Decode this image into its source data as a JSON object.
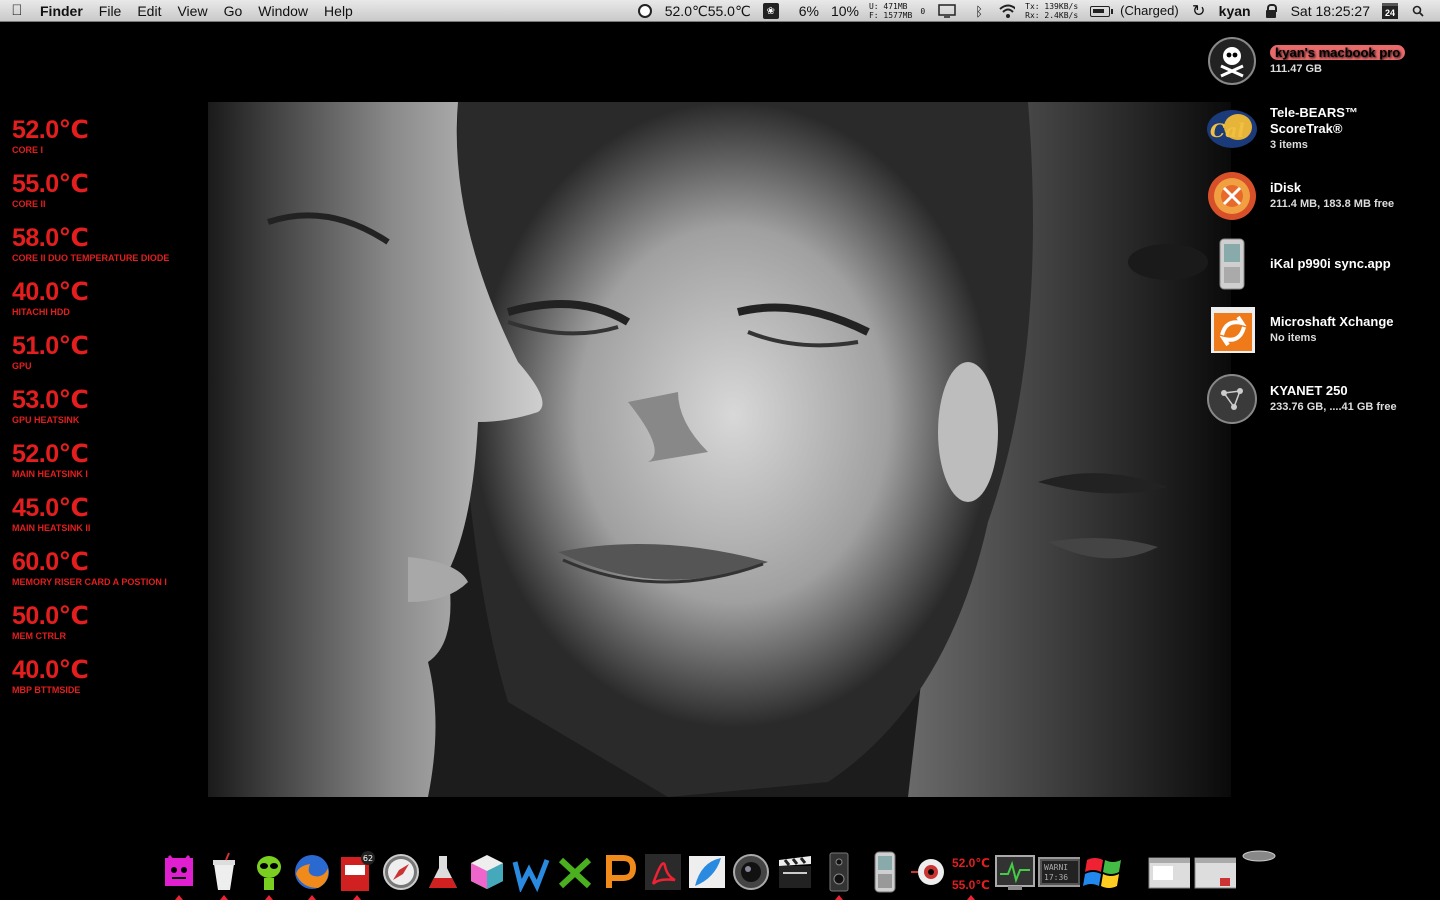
{
  "menubar": {
    "app_name": "Finder",
    "menus": [
      "File",
      "Edit",
      "View",
      "Go",
      "Window",
      "Help"
    ],
    "temp1": "52.0℃",
    "temp2": "55.0℃",
    "cpu1": "6%",
    "cpu2": "10%",
    "mem_u": "U:   471MB",
    "mem_f": "F: 1577MB",
    "disk_count": "0",
    "net_tx": "Tx:  139KB/s",
    "net_rx": "Rx:   2.4KB/s",
    "battery_status": "(Charged)",
    "user": "kyan",
    "clock": "Sat 18:25:27",
    "calendar_day": "24"
  },
  "temperature_sensors": [
    {
      "value": "52.0℃",
      "label": "CORE I"
    },
    {
      "value": "55.0℃",
      "label": "CORE II"
    },
    {
      "value": "58.0℃",
      "label": "CORE II DUO TEMPERATURE DIODE"
    },
    {
      "value": "40.0℃",
      "label": "HITACHI HDD"
    },
    {
      "value": "51.0℃",
      "label": "GPU"
    },
    {
      "value": "53.0℃",
      "label": "GPU HEATSINK"
    },
    {
      "value": "52.0℃",
      "label": "MAIN HEATSINK I"
    },
    {
      "value": "45.0℃",
      "label": "MAIN HEATSINK II"
    },
    {
      "value": "60.0℃",
      "label": "MEMORY RISER CARD A POSTION I"
    },
    {
      "value": "50.0℃",
      "label": "MEM CTRLR"
    },
    {
      "value": "40.0℃",
      "label": "MBP BTTMSIDE"
    }
  ],
  "desktop_icons": [
    {
      "name": "kyan's macbook pro",
      "sub": "111.47 GB",
      "icon": "skull-drive-icon"
    },
    {
      "name": "Tele-BEARS™",
      "name2": "ScoreTrak®",
      "sub": "3 items",
      "icon": "cal-bears-icon"
    },
    {
      "name": "iDisk",
      "sub": "211.4 MB, 183.8 MB free",
      "icon": "idisk-icon"
    },
    {
      "name": "iKal p990i sync.app",
      "sub": "",
      "icon": "phone-app-icon"
    },
    {
      "name": "Microshaft Xchange",
      "sub": "No items",
      "icon": "xchange-icon"
    },
    {
      "name": "KYANET 250",
      "sub": "233.76 GB, ....41 GB free",
      "icon": "network-drive-icon"
    }
  ],
  "dock": {
    "mail_badge": "62",
    "temp1": "52.0℃",
    "temp2": "55.0℃",
    "monitor_text1": "WARNI",
    "monitor_text2": "17:36"
  },
  "colors": {
    "temp_red": "#e41e1e",
    "highlight": "#e86a6a"
  }
}
